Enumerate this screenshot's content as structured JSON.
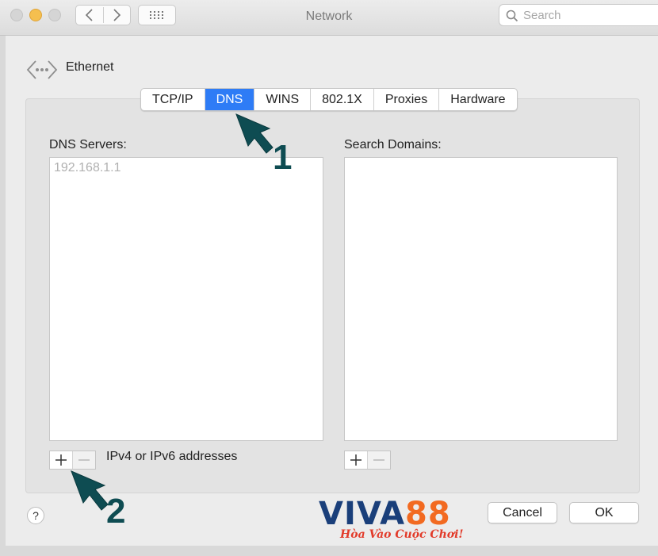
{
  "window": {
    "title": "Network"
  },
  "search": {
    "placeholder": "Search"
  },
  "interface": {
    "name": "Ethernet"
  },
  "tabs": [
    {
      "label": "TCP/IP",
      "active": false
    },
    {
      "label": "DNS",
      "active": true
    },
    {
      "label": "WINS",
      "active": false
    },
    {
      "label": "802.1X",
      "active": false
    },
    {
      "label": "Proxies",
      "active": false
    },
    {
      "label": "Hardware",
      "active": false
    }
  ],
  "dns_servers": {
    "label": "DNS Servers:",
    "entries": [
      "192.168.1.1"
    ]
  },
  "search_domains": {
    "label": "Search Domains:",
    "entries": []
  },
  "hint": "IPv4 or IPv6 addresses",
  "help": "?",
  "buttons": {
    "cancel": "Cancel",
    "ok": "OK"
  },
  "annotations": {
    "step1": "1",
    "step2": "2"
  },
  "logo": {
    "part1": "VIVA",
    "part2": "88",
    "slogan": "Hòa Vào Cuộc Chơi!"
  },
  "colors": {
    "accent": "#2e7cf6",
    "annotation": "#0e4c52",
    "logo_blue": "#1a3f7a",
    "logo_orange": "#f26a21"
  }
}
